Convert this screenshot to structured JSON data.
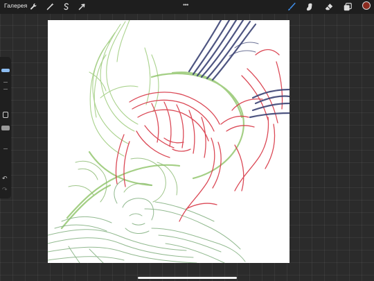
{
  "topbar": {
    "gallery_label": "Галерея",
    "more_label": "•••",
    "actions_icon": "wrench-icon",
    "adjustments_icon": "magic-wand-icon",
    "selection_icon": "selection-s-icon",
    "transform_icon": "arrow-cursor-icon",
    "brush_icon": "brush-icon",
    "smudge_icon": "smudge-finger-icon",
    "eraser_icon": "eraser-icon",
    "layers_icon": "layers-icon",
    "current_color": "#8a2a1e",
    "brush_active_color": "#3e8de8"
  },
  "sidebar": {
    "brush_size_level": 0.9,
    "opacity_level": 0.5,
    "undo_glyph": "↶",
    "redo_glyph": "↷"
  },
  "canvas": {
    "background": "#ffffff",
    "stroke_colors": {
      "green": "#8ec467",
      "sage": "#86b283",
      "red": "#d83a48",
      "navy": "#3b4374"
    }
  }
}
